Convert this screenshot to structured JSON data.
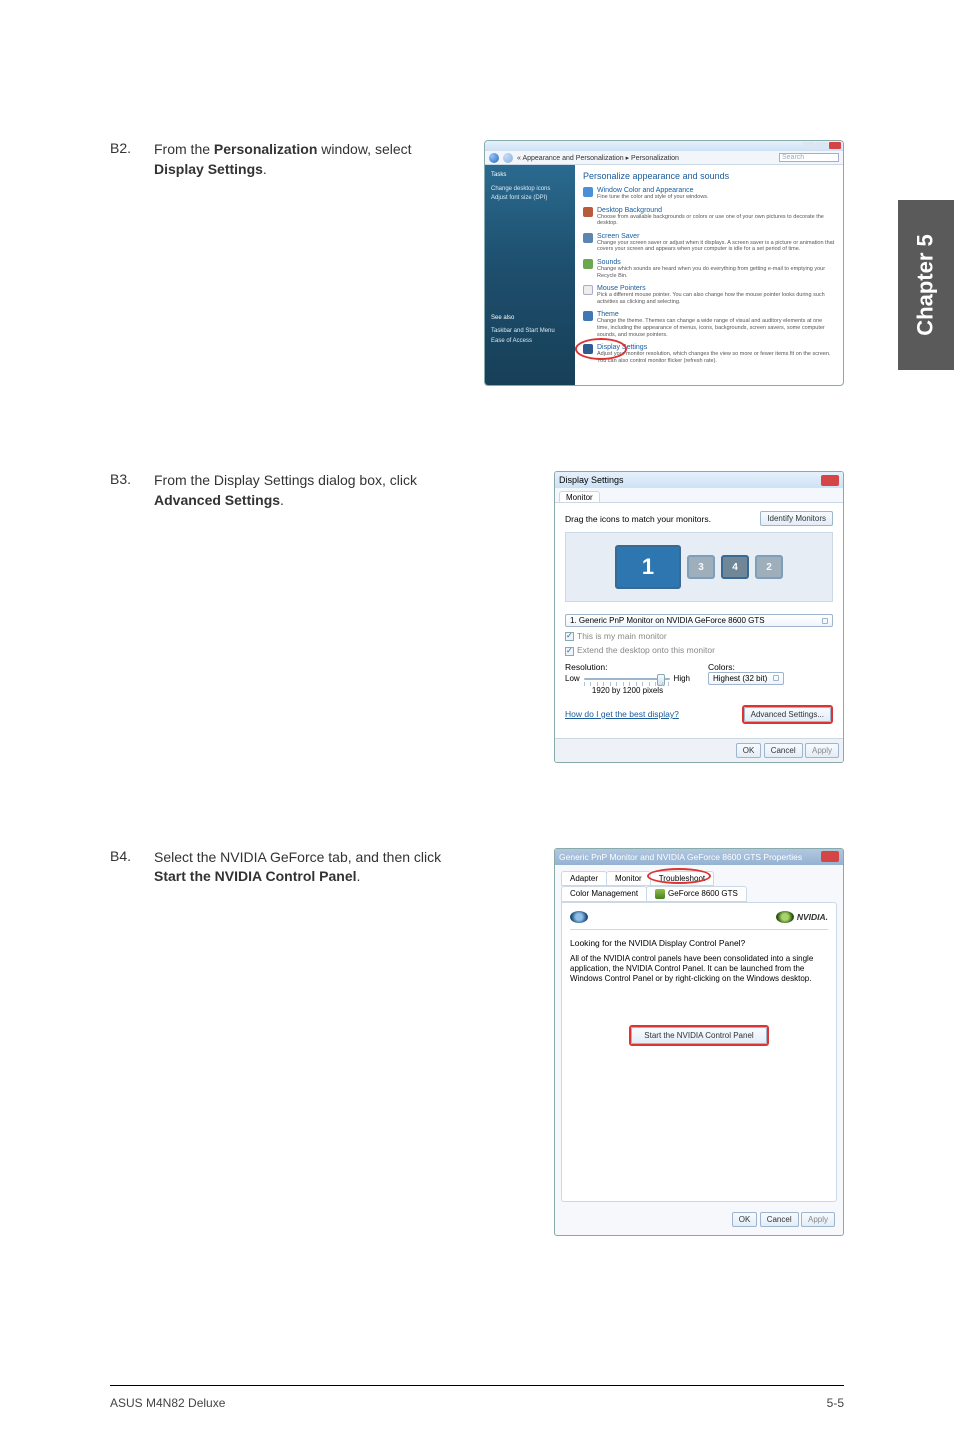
{
  "chapter_tab": "Chapter 5",
  "steps": {
    "b2": {
      "num": "B2.",
      "text_parts": [
        "From the ",
        "Personalization",
        " window, select ",
        "Display Settings",
        "."
      ]
    },
    "b3": {
      "num": "B3.",
      "text_parts": [
        "From the Display Settings dialog box, click ",
        "Advanced Settings",
        "."
      ]
    },
    "b4": {
      "num": "B4.",
      "text_parts": [
        "Select the NVIDIA GeForce tab, and then click ",
        "Start the NVIDIA Control Panel",
        "."
      ]
    }
  },
  "personalization": {
    "breadcrumb": "« Appearance and Personalization ▸ Personalization",
    "search_placeholder": "Search",
    "sidebar": {
      "tasks": "Tasks",
      "items": [
        "Change desktop icons",
        "Adjust font size (DPI)"
      ],
      "see_also": "See also",
      "see_items": [
        "Taskbar and Start Menu",
        "Ease of Access"
      ]
    },
    "heading": "Personalize appearance and sounds",
    "items": [
      {
        "title": "Window Color and Appearance",
        "desc": "Fine tune the color and style of your windows."
      },
      {
        "title": "Desktop Background",
        "desc": "Choose from available backgrounds or colors or use one of your own pictures to decorate the desktop."
      },
      {
        "title": "Screen Saver",
        "desc": "Change your screen saver or adjust when it displays. A screen saver is a picture or animation that covers your screen and appears when your computer is idle for a set period of time."
      },
      {
        "title": "Sounds",
        "desc": "Change which sounds are heard when you do everything from getting e-mail to emptying your Recycle Bin."
      },
      {
        "title": "Mouse Pointers",
        "desc": "Pick a different mouse pointer. You can also change how the mouse pointer looks during such activities as clicking and selecting."
      },
      {
        "title": "Theme",
        "desc": "Change the theme. Themes can change a wide range of visual and auditory elements at one time, including the appearance of menus, icons, backgrounds, screen savers, some computer sounds, and mouse pointers."
      },
      {
        "title": "Display Settings",
        "desc": "Adjust your monitor resolution, which changes the view so more or fewer items fit on the screen. You can also control monitor flicker (refresh rate).",
        "circled": true
      }
    ]
  },
  "display_settings": {
    "title": "Display Settings",
    "tab": "Monitor",
    "drag_text": "Drag the icons to match your monitors.",
    "identify_btn": "Identify Monitors",
    "monitors": [
      "1",
      "3",
      "4",
      "2"
    ],
    "dropdown": "1. Generic PnP Monitor on NVIDIA GeForce 8600 GTS",
    "chk_main": "This is my main monitor",
    "chk_extend": "Extend the desktop onto this monitor",
    "resolution_label": "Resolution:",
    "low": "Low",
    "high": "High",
    "resolution_value": "1920 by 1200 pixels",
    "colors_label": "Colors:",
    "colors_value": "Highest (32 bit)",
    "help_link": "How do I get the best display?",
    "advanced_btn": "Advanced Settings...",
    "ok": "OK",
    "cancel": "Cancel",
    "apply": "Apply"
  },
  "properties": {
    "title": "Generic PnP Monitor and NVIDIA GeForce 8600 GTS Properties",
    "tabs_row1": [
      "Adapter",
      "Monitor",
      "Troubleshoot"
    ],
    "tabs_row2": [
      "Color Management",
      "GeForce 8600 GTS"
    ],
    "nvidia_logo": "NVIDIA.",
    "question": "Looking for the NVIDIA Display Control Panel?",
    "explain": "All of the NVIDIA control panels have been consolidated into a single application, the NVIDIA Control Panel. It can be launched from the Windows Control Panel or by right-clicking on the Windows desktop.",
    "start_btn": "Start the NVIDIA Control Panel",
    "ok": "OK",
    "cancel": "Cancel",
    "apply": "Apply"
  },
  "footer": {
    "left": "ASUS M4N82 Deluxe",
    "right": "5-5"
  }
}
